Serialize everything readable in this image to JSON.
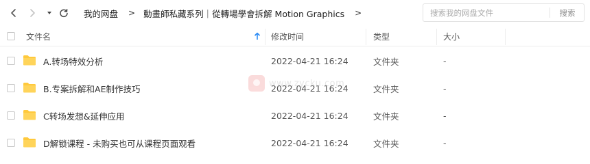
{
  "breadcrumb": {
    "items": [
      "我的网盘",
      "動畫師私藏系列｜從轉場學會拆解 Motion Graphics"
    ],
    "separator": ">"
  },
  "search": {
    "placeholder": "搜索我的网盘文件",
    "button_label": "搜索"
  },
  "header": {
    "name": "文件名",
    "modified": "修改时间",
    "type": "类型",
    "size": "大小"
  },
  "files": [
    {
      "name": "A.转场特效分析",
      "modified": "2022-04-21 16:24",
      "type": "文件夹",
      "size": "-"
    },
    {
      "name": "B.专案拆解和AE制作技巧",
      "modified": "2022-04-21 16:24",
      "type": "文件夹",
      "size": "-"
    },
    {
      "name": "C转场发想&延伸应用",
      "modified": "2022-04-21 16:24",
      "type": "文件夹",
      "size": "-"
    },
    {
      "name": "D解锁课程 - 未购买也可从课程页面观看",
      "modified": "2022-04-21 16:24",
      "type": "文件夹",
      "size": "-"
    }
  ],
  "watermark": {
    "text": "www.zycku.com"
  },
  "colors": {
    "folder": "#ffc93c",
    "accent": "#1e88e5",
    "border": "#ededed",
    "nav_disabled": "#c4c4c4"
  },
  "icons": {
    "back": "chevron-left-icon",
    "forward": "chevron-right-icon",
    "history": "caret-down-icon",
    "refresh": "refresh-icon",
    "sort": "sort-ascending-icon",
    "folder": "folder-icon"
  }
}
